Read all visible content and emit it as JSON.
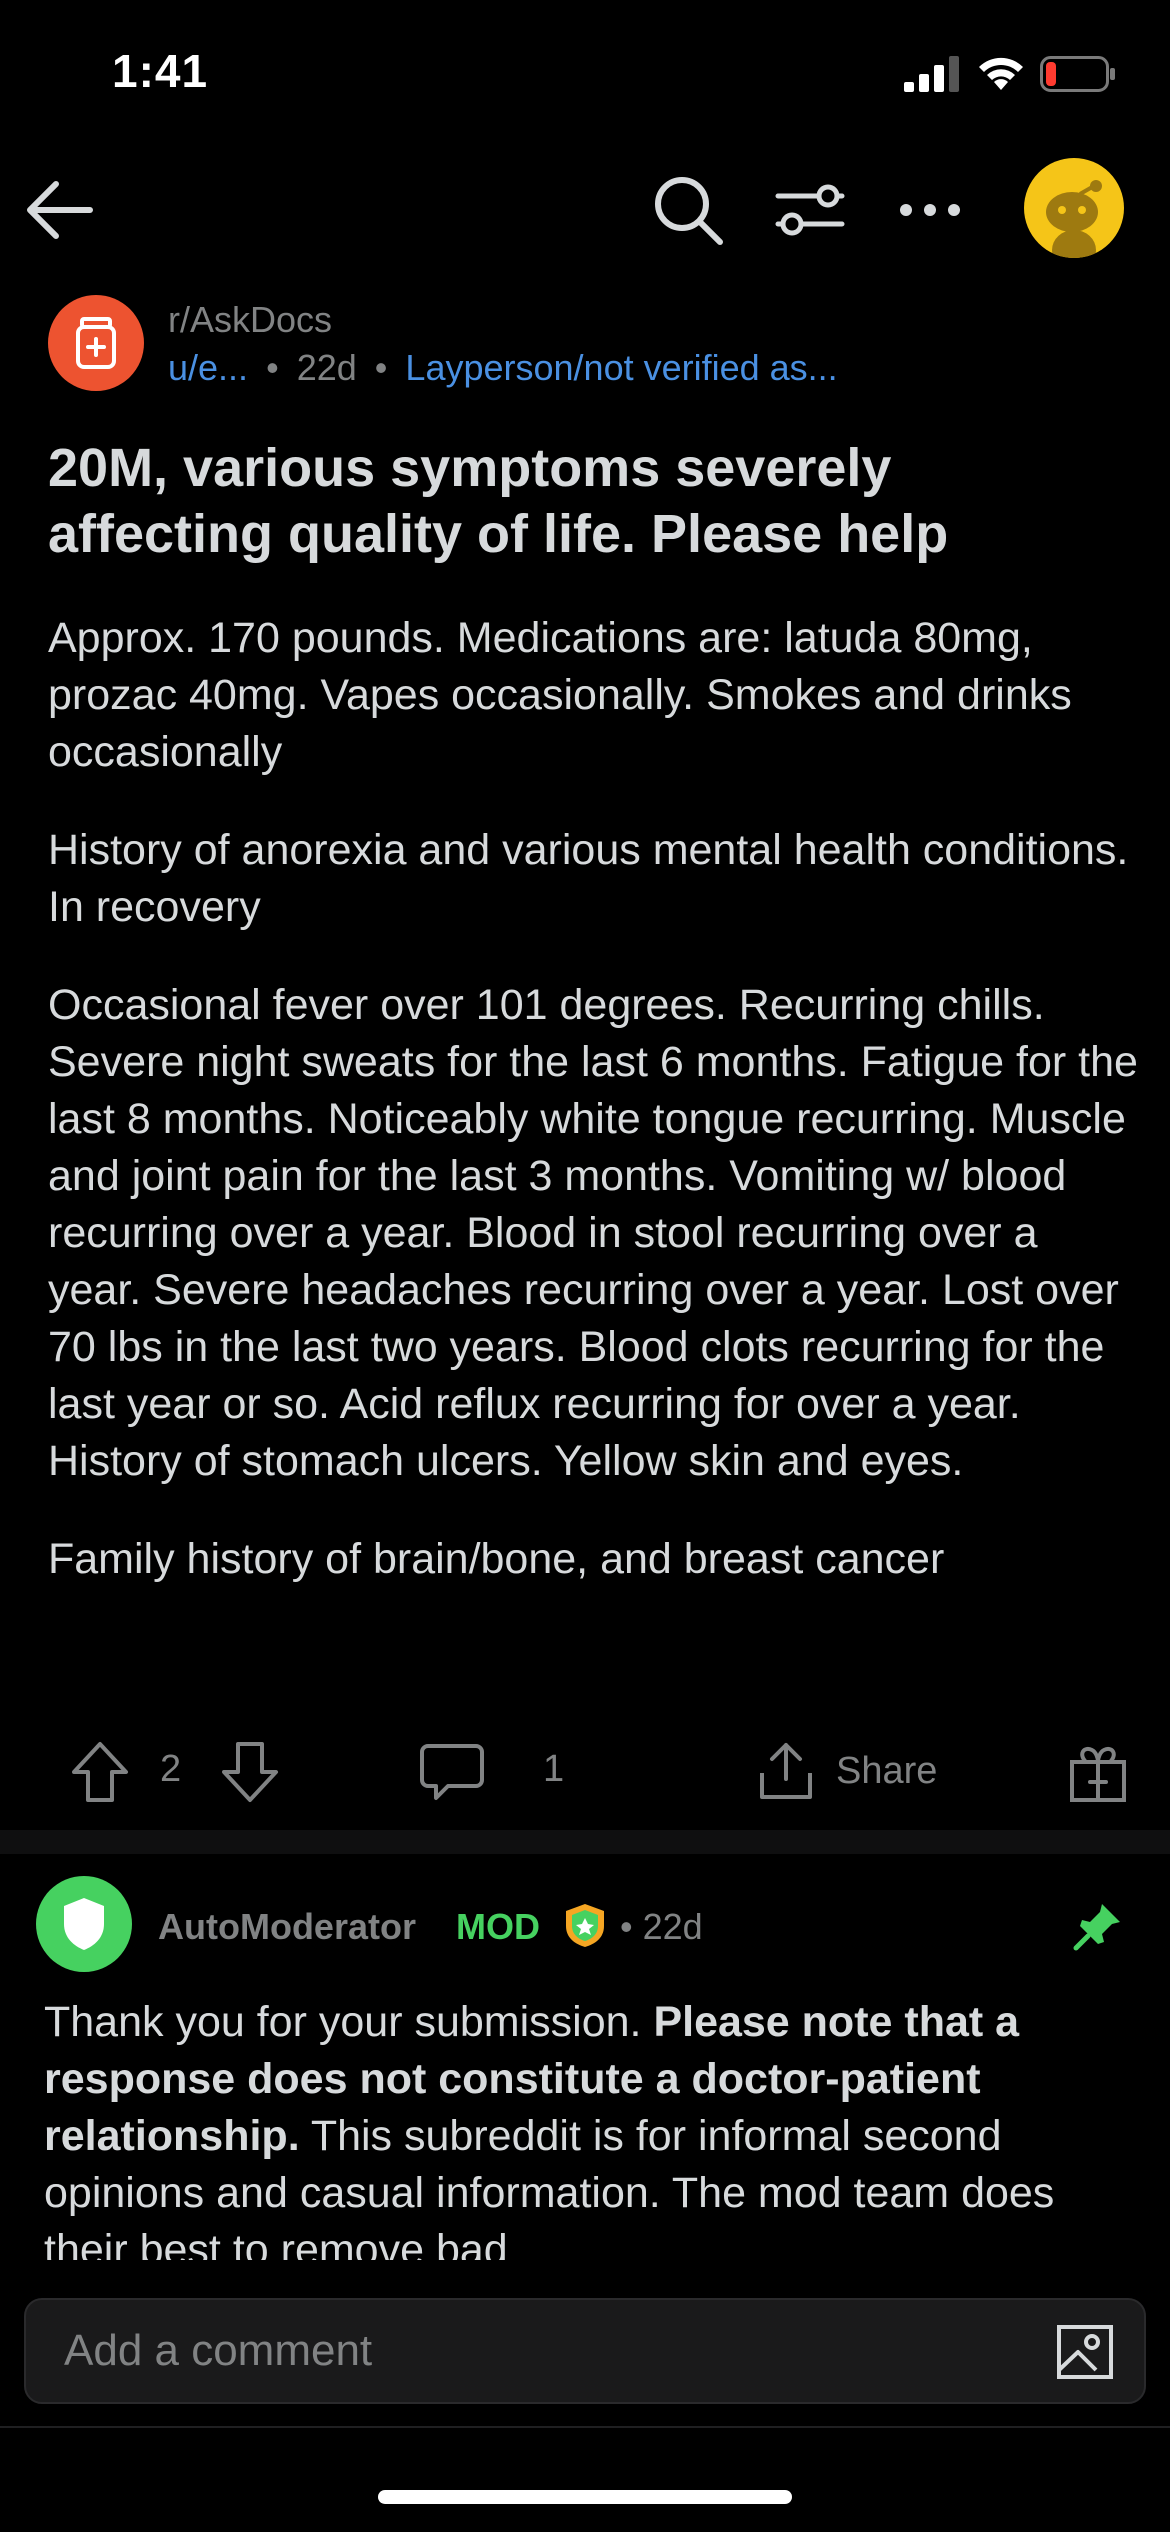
{
  "status_bar": {
    "time": "1:41",
    "battery_color": "#ff3b30"
  },
  "nav": {
    "icons": [
      "back-arrow-icon",
      "search-icon",
      "sort-icon",
      "more-icon",
      "avatar"
    ]
  },
  "post": {
    "subreddit": "r/AskDocs",
    "author": "u/e...",
    "separator": "•",
    "age": "22d",
    "flair": "Layperson/not verified as...",
    "title": "20M, various symptoms severely affecting quality of life. Please help",
    "paragraphs": [
      "Approx. 170 pounds. Medications are: latuda 80mg, prozac 40mg. Vapes occasionally. Smokes and drinks occasionally",
      "History of anorexia and various mental health conditions. In recovery",
      "Occasional fever over 101 degrees. Recurring chills. Severe night sweats for the last 6 months. Fatigue for the last 8 months. Noticeably white tongue recurring. Muscle and joint pain for the last 3 months. Vomiting w/ blood recurring over a year. Blood in stool recurring over a year. Severe headaches recurring over a year. Lost over 70 lbs in the last two years. Blood clots recurring for the last year or so. Acid reflux recurring for over a year. History of stomach ulcers. Yellow skin and eyes.",
      "Family history of brain/bone, and breast cancer"
    ],
    "votes": "2",
    "comments": "1",
    "share_label": "Share"
  },
  "comment": {
    "author": "AutoModerator",
    "mod_tag": "MOD",
    "separator": "•",
    "age": "22d",
    "text_plain_1": "Thank you for your submission. ",
    "text_bold": "Please note that a response does not constitute a doctor-patient relationship.",
    "text_plain_2": " This subreddit is for informal second opinions and casual information. The mod team does their best to remove bad"
  },
  "composer": {
    "placeholder": "Add a comment"
  },
  "colors": {
    "background": "#000000",
    "text": "#d7dadc",
    "muted": "#818384",
    "link_blue": "#4a90e2",
    "subreddit_orange": "#ed5330",
    "mod_green": "#46d160",
    "avatar_yellow": "#f5c518"
  }
}
